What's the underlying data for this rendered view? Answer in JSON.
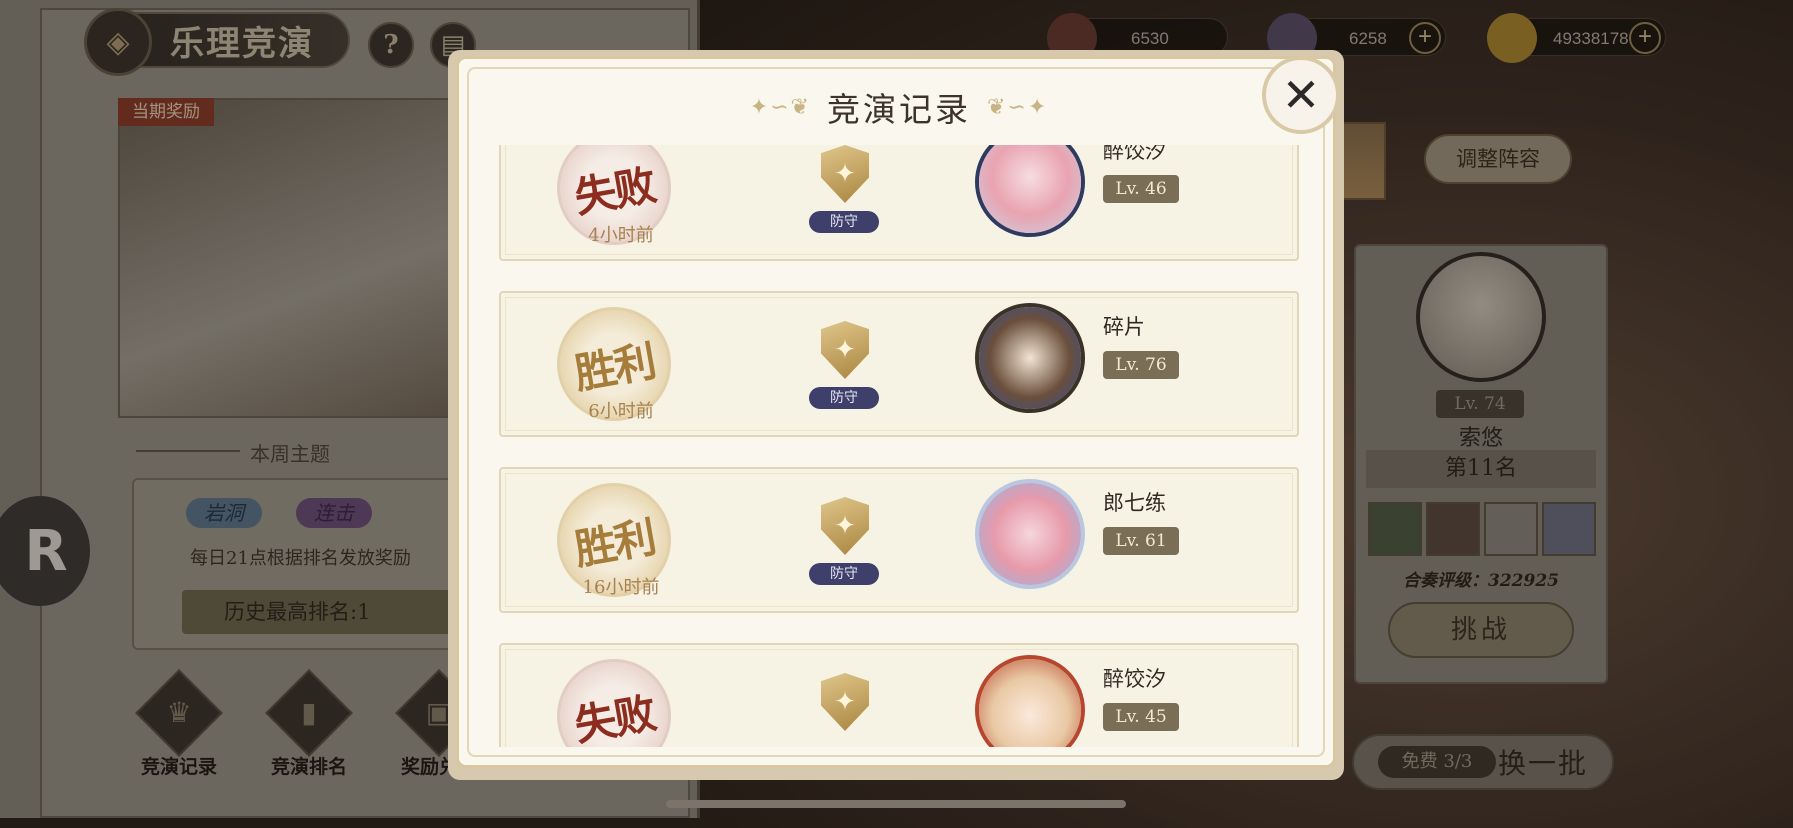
{
  "left_panel": {
    "title": "乐理竞演",
    "help_icon": "?",
    "reward_tag": "当期奖励",
    "week_theme": "本周主题",
    "tags": [
      "岩洞",
      "连击"
    ],
    "daily_info": "每日21点根据排名发放奖励",
    "best_rank": "历史最高排名:1",
    "bottom_buttons": [
      {
        "label": "竞演记录",
        "icon": "trophy-icon"
      },
      {
        "label": "竞演排名",
        "icon": "bar-chart-icon"
      },
      {
        "label": "奖励兑换",
        "icon": "gift-icon"
      }
    ]
  },
  "currencies": [
    {
      "value": "6530",
      "icon": "book-icon",
      "has_plus": false
    },
    {
      "value": "6258",
      "icon": "crystal-icon",
      "has_plus": true
    },
    {
      "value": "49338178",
      "icon": "gold-coin-icon",
      "has_plus": true
    }
  ],
  "right_panel": {
    "adjust_label": "调整阵容",
    "opponent": {
      "level": "Lv. 74",
      "name": "索悠",
      "rank": "第11名",
      "rating": "合奏评级：322925"
    },
    "challenge_label": "挑战",
    "free_label": "免费 3/3",
    "refresh_label": "换一批"
  },
  "modal": {
    "title": "竞演记录",
    "records": [
      {
        "result": "失败",
        "outcome": "lose",
        "time": "4小时前",
        "role": "防守",
        "name": "醉饺汐",
        "level": "Lv. 46"
      },
      {
        "result": "胜利",
        "outcome": "win",
        "time": "6小时前",
        "role": "防守",
        "name": "碎片",
        "level": "Lv. 76"
      },
      {
        "result": "胜利",
        "outcome": "win",
        "time": "16小时前",
        "role": "防守",
        "name": "郎七练",
        "level": "Lv. 61"
      },
      {
        "result": "失败",
        "outcome": "lose",
        "time": "",
        "role": "",
        "name": "醉饺汐",
        "level": "Lv. 45"
      }
    ]
  },
  "colors": {
    "modal_bg": "#faf7ef",
    "lose_stamp": "#8c2d1f",
    "win_stamp": "#a67c3a",
    "role_badge": "#3e3f6a",
    "level_badge": "#7a6f56"
  }
}
